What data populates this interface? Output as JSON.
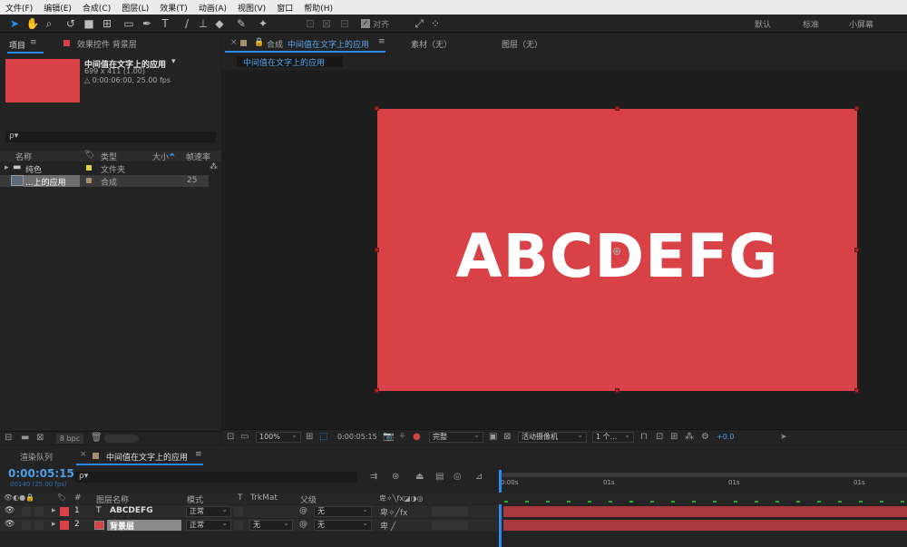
{
  "menu": [
    "文件(F)",
    "编辑(E)",
    "合成(C)",
    "图层(L)",
    "效果(T)",
    "动画(A)",
    "视图(V)",
    "窗口",
    "帮助(H)"
  ],
  "toolbar": {
    "align_label": "对齐",
    "workspaces": [
      "默认",
      "标准",
      "小屏幕"
    ]
  },
  "project": {
    "tab_project": "项目",
    "tab_effects": "效果控件 背景层",
    "comp_name": "中间值在文字上的应用",
    "comp_dims": "699 x 411 (1.00)",
    "comp_duration": "△ 0:00:06:00, 25.00 fps",
    "search_placeholder": "ρ▾",
    "columns": {
      "name": "名称",
      "type": "类型",
      "size": "大小",
      "fps": "帧速率"
    },
    "items": [
      {
        "name": "纯色",
        "type": "文件夹",
        "fps": ""
      },
      {
        "name": "...上的应用",
        "type": "合成",
        "fps": "25"
      }
    ],
    "bpc": "8 bpc"
  },
  "viewer": {
    "tab_comp_prefix": "合成",
    "tab_comp_name": "中间值在文字上的应用",
    "tab_footage": "素材（无）",
    "tab_layer": "图层（无）",
    "breadcrumb": "中间值在文字上的应用",
    "canvas_text": "ABCDEFG",
    "canvas_color": "#d84247",
    "zoom": "100%",
    "timecode": "0:00:05:15",
    "resolution": "完整",
    "camera": "活动摄像机",
    "views": "1 个...",
    "exposure": "+0.0"
  },
  "timeline": {
    "tab_render": "渲染队列",
    "tab_comp": "中间值在文字上的应用",
    "timecode": "0:00:05:15",
    "timecode_sub": "00140 (25.00 fps)",
    "columns": {
      "num": "#",
      "layer_name": "图层名称",
      "mode": "模式",
      "t": "T",
      "trkmat": "TrkMat",
      "parent": "父级"
    },
    "ruler": [
      "0:00s",
      "01s",
      "01s",
      "01s"
    ],
    "layers": [
      {
        "num": "1",
        "type_icon": "T",
        "name": "ABCDEFG",
        "mode": "正常",
        "trkmat": "",
        "parent": "无"
      },
      {
        "num": "2",
        "type_icon": "■",
        "name": "背景层",
        "mode": "正常",
        "trkmat": "无",
        "parent": "无"
      }
    ]
  },
  "colors": {
    "accent": "#2d8ceb",
    "label_red": "#d84247",
    "label_yellow": "#e6d24a",
    "bar_red": "#a9373e"
  }
}
